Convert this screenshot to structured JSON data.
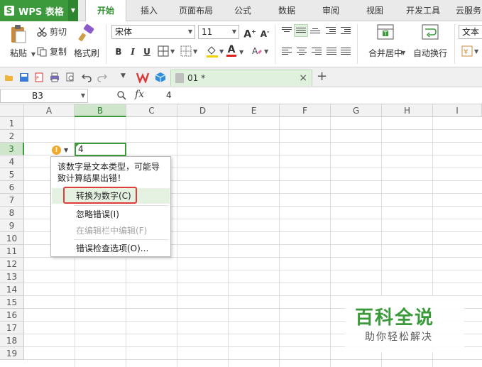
{
  "app": {
    "title": "WPS 表格",
    "logo_letter": "S"
  },
  "menu": {
    "tabs": [
      {
        "label": "开始",
        "active": true
      },
      {
        "label": "插入"
      },
      {
        "label": "页面布局"
      },
      {
        "label": "公式"
      },
      {
        "label": "数据"
      },
      {
        "label": "审阅"
      },
      {
        "label": "视图"
      },
      {
        "label": "开发工具"
      },
      {
        "label": "云服务"
      }
    ]
  },
  "ribbon": {
    "paste": "粘贴",
    "cut": "剪切",
    "copy": "复制",
    "format_painter": "格式刷",
    "font_name": "宋体",
    "font_size": "11",
    "bold": "B",
    "italic": "I",
    "underline": "U",
    "font_color_letter": "A",
    "merge_center": "合并居中",
    "wrap_text": "自动换行",
    "number_format": "文本"
  },
  "document": {
    "tab_name": "01 *"
  },
  "formula_bar": {
    "name_box": "B3",
    "fx": "fx",
    "value": "4"
  },
  "grid": {
    "columns": [
      "A",
      "B",
      "C",
      "D",
      "E",
      "F",
      "G",
      "H",
      "I"
    ],
    "rows": [
      "1",
      "2",
      "3",
      "4",
      "5",
      "6",
      "7",
      "8",
      "9",
      "10",
      "11",
      "12",
      "13",
      "14",
      "15",
      "16",
      "17",
      "18",
      "19"
    ],
    "active_cell_value": "4",
    "warn_glyph": "!"
  },
  "popup": {
    "message": "该数字是文本类型，可能导致计算结果出错！",
    "items": [
      {
        "label": "转换为数字(C)",
        "highlighted": true
      },
      {
        "label": "忽略错误(I)"
      },
      {
        "label": "在编辑栏中编辑(F)",
        "disabled": true
      },
      {
        "label": "错误检查选项(O)..."
      }
    ]
  },
  "watermark": {
    "title": "百科全说",
    "subtitle": "助你轻松解决"
  },
  "colors": {
    "accent_green": "#3c9a3c",
    "highlight_red": "#e13c3c",
    "warn_orange": "#f0a92a"
  }
}
